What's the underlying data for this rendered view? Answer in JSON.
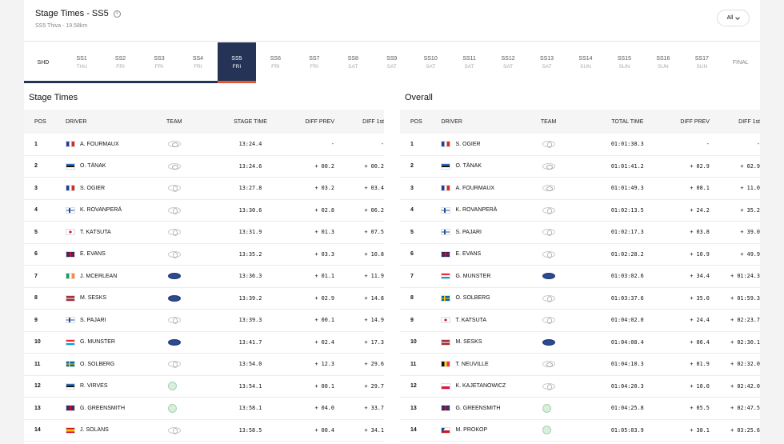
{
  "header": {
    "title": "Stage Times - SS5",
    "subtitle": "SS5 Thiva - 19.58km",
    "filter_label": "All"
  },
  "stages": [
    {
      "code": "SHD",
      "day": "",
      "type": "shd"
    },
    {
      "code": "SS1",
      "day": "THU"
    },
    {
      "code": "SS2",
      "day": "FRI"
    },
    {
      "code": "SS3",
      "day": "FRI"
    },
    {
      "code": "SS4",
      "day": "FRI"
    },
    {
      "code": "SS5",
      "day": "FRI",
      "active": true
    },
    {
      "code": "SS6",
      "day": "FRI"
    },
    {
      "code": "SS7",
      "day": "FRI"
    },
    {
      "code": "SS8",
      "day": "SAT"
    },
    {
      "code": "SS9",
      "day": "SAT"
    },
    {
      "code": "SS10",
      "day": "SAT"
    },
    {
      "code": "SS11",
      "day": "SAT"
    },
    {
      "code": "SS12",
      "day": "SAT"
    },
    {
      "code": "SS13",
      "day": "SAT"
    },
    {
      "code": "SS14",
      "day": "SUN"
    },
    {
      "code": "SS15",
      "day": "SUN"
    },
    {
      "code": "SS16",
      "day": "SUN"
    },
    {
      "code": "SS17",
      "day": "SUN"
    },
    {
      "code": "FINAL",
      "day": "",
      "type": "final"
    }
  ],
  "stage_times": {
    "title": "Stage Times",
    "columns": {
      "pos": "POS",
      "driver": "DRIVER",
      "team": "TEAM",
      "time": "STAGE TIME",
      "prev": "DIFF PREV",
      "first": "DIFF 1st"
    },
    "rows": [
      {
        "pos": "1",
        "flag": "fr",
        "driver": "A. FOURMAUX",
        "team": "hyundai",
        "time": "13:24.4",
        "prev": "-",
        "first": "-"
      },
      {
        "pos": "2",
        "flag": "ee",
        "driver": "O. TÄNAK",
        "team": "hyundai",
        "time": "13:24.6",
        "prev": "+ 00.2",
        "first": "+ 00.2"
      },
      {
        "pos": "3",
        "flag": "fr",
        "driver": "S. OGIER",
        "team": "toyota",
        "time": "13:27.8",
        "prev": "+ 03.2",
        "first": "+ 03.4"
      },
      {
        "pos": "4",
        "flag": "fi",
        "driver": "K. ROVANPERÄ",
        "team": "toyota",
        "time": "13:30.6",
        "prev": "+ 02.8",
        "first": "+ 06.2"
      },
      {
        "pos": "5",
        "flag": "jp",
        "driver": "T. KATSUTA",
        "team": "toyota",
        "time": "13:31.9",
        "prev": "+ 01.3",
        "first": "+ 07.5"
      },
      {
        "pos": "6",
        "flag": "gb",
        "driver": "E. EVANS",
        "team": "toyota",
        "time": "13:35.2",
        "prev": "+ 03.3",
        "first": "+ 10.8"
      },
      {
        "pos": "7",
        "flag": "ie",
        "driver": "J. MCERLEAN",
        "team": "ford",
        "time": "13:36.3",
        "prev": "+ 01.1",
        "first": "+ 11.9"
      },
      {
        "pos": "8",
        "flag": "lv",
        "driver": "M. SESKS",
        "team": "ford",
        "time": "13:39.2",
        "prev": "+ 02.9",
        "first": "+ 14.8"
      },
      {
        "pos": "9",
        "flag": "fi",
        "driver": "S. PAJARI",
        "team": "toyota",
        "time": "13:39.3",
        "prev": "+ 00.1",
        "first": "+ 14.9"
      },
      {
        "pos": "10",
        "flag": "lu",
        "driver": "G. MUNSTER",
        "team": "ford",
        "time": "13:41.7",
        "prev": "+ 02.4",
        "first": "+ 17.3"
      },
      {
        "pos": "11",
        "flag": "se",
        "driver": "O. SOLBERG",
        "team": "toyota",
        "time": "13:54.0",
        "prev": "+ 12.3",
        "first": "+ 29.6"
      },
      {
        "pos": "12",
        "flag": "ee",
        "driver": "R. VIRVES",
        "team": "skoda",
        "time": "13:54.1",
        "prev": "+ 00.1",
        "first": "+ 29.7"
      },
      {
        "pos": "13",
        "flag": "gb",
        "driver": "G. GREENSMITH",
        "team": "skoda",
        "time": "13:58.1",
        "prev": "+ 04.0",
        "first": "+ 33.7"
      },
      {
        "pos": "14",
        "flag": "es",
        "driver": "J. SOLANS",
        "team": "toyota",
        "time": "13:58.5",
        "prev": "+ 00.4",
        "first": "+ 34.1"
      }
    ]
  },
  "overall": {
    "title": "Overall",
    "columns": {
      "pos": "POS",
      "driver": "DRIVER",
      "team": "TEAM",
      "time": "TOTAL TIME",
      "prev": "DIFF PREV",
      "first": "DIFF 1st"
    },
    "rows": [
      {
        "pos": "1",
        "flag": "fr",
        "driver": "S. OGIER",
        "team": "toyota",
        "time": "01:01:38.3",
        "prev": "-",
        "first": "-"
      },
      {
        "pos": "2",
        "flag": "ee",
        "driver": "O. TÄNAK",
        "team": "hyundai",
        "time": "01:01:41.2",
        "prev": "+ 02.9",
        "first": "+ 02.9"
      },
      {
        "pos": "3",
        "flag": "fr",
        "driver": "A. FOURMAUX",
        "team": "hyundai",
        "time": "01:01:49.3",
        "prev": "+ 08.1",
        "first": "+ 11.0"
      },
      {
        "pos": "4",
        "flag": "fi",
        "driver": "K. ROVANPERÄ",
        "team": "toyota",
        "time": "01:02:13.5",
        "prev": "+ 24.2",
        "first": "+ 35.2"
      },
      {
        "pos": "5",
        "flag": "fi",
        "driver": "S. PAJARI",
        "team": "toyota",
        "time": "01:02:17.3",
        "prev": "+ 03.8",
        "first": "+ 39.0"
      },
      {
        "pos": "6",
        "flag": "gb",
        "driver": "E. EVANS",
        "team": "toyota",
        "time": "01:02:28.2",
        "prev": "+ 10.9",
        "first": "+ 49.9"
      },
      {
        "pos": "7",
        "flag": "lu",
        "driver": "G. MUNSTER",
        "team": "ford",
        "time": "01:03:02.6",
        "prev": "+ 34.4",
        "first": "+ 01:24.3"
      },
      {
        "pos": "8",
        "flag": "se",
        "driver": "O. SOLBERG",
        "team": "toyota",
        "time": "01:03:37.6",
        "prev": "+ 35.0",
        "first": "+ 01:59.3"
      },
      {
        "pos": "9",
        "flag": "jp",
        "driver": "T. KATSUTA",
        "team": "toyota",
        "time": "01:04:02.0",
        "prev": "+ 24.4",
        "first": "+ 02:23.7"
      },
      {
        "pos": "10",
        "flag": "lv",
        "driver": "M. SESKS",
        "team": "ford",
        "time": "01:04:08.4",
        "prev": "+ 06.4",
        "first": "+ 02:30.1"
      },
      {
        "pos": "11",
        "flag": "be",
        "driver": "T. NEUVILLE",
        "team": "hyundai",
        "time": "01:04:10.3",
        "prev": "+ 01.9",
        "first": "+ 02:32.0"
      },
      {
        "pos": "12",
        "flag": "pl",
        "driver": "K. KAJETANOWICZ",
        "team": "toyota",
        "time": "01:04:20.3",
        "prev": "+ 10.0",
        "first": "+ 02:42.0"
      },
      {
        "pos": "13",
        "flag": "gb",
        "driver": "G. GREENSMITH",
        "team": "skoda",
        "time": "01:04:25.8",
        "prev": "+ 05.5",
        "first": "+ 02:47.5"
      },
      {
        "pos": "14",
        "flag": "cz",
        "driver": "M. PROKOP",
        "team": "skoda",
        "time": "01:05:03.9",
        "prev": "+ 38.1",
        "first": "+ 03:25.6"
      }
    ]
  },
  "colors": {
    "active_stage": "#253356",
    "active_underline": "#e8542f"
  }
}
